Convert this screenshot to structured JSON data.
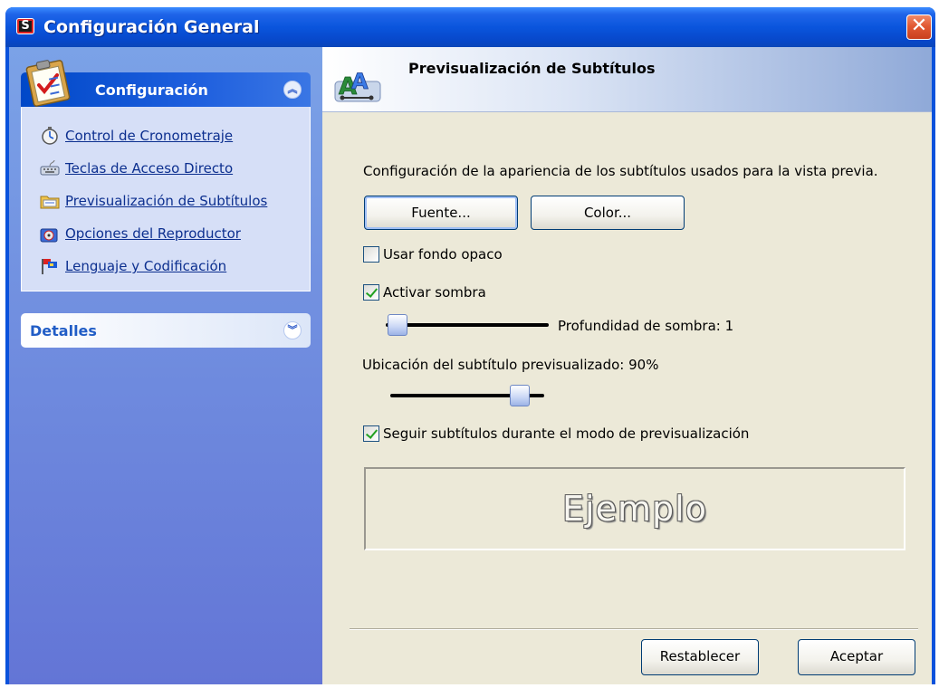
{
  "window": {
    "title": "Configuración General",
    "app_icon_letter": "S"
  },
  "sidebar": {
    "group1": {
      "title": "Configuración",
      "items": [
        {
          "label": "Control de Cronometraje",
          "icon": "stopwatch-icon"
        },
        {
          "label": "Teclas de Acceso Directo",
          "icon": "keyboard-icon"
        },
        {
          "label": "Previsualización de Subtítulos",
          "icon": "folder-icon"
        },
        {
          "label": "Opciones del Reproductor",
          "icon": "media-player-icon"
        },
        {
          "label": "Lenguaje y Codificación",
          "icon": "flags-icon"
        }
      ]
    },
    "group2": {
      "title": "Detalles"
    }
  },
  "panel": {
    "header_title": "Previsualización de Subtítulos",
    "description": "Configuración de la apariencia de los subtítulos usados para la vista previa.",
    "font_button": "Fuente...",
    "color_button": "Color...",
    "opaque_bg_label": "Usar fondo opaco",
    "opaque_bg_checked": false,
    "shadow_label": "Activar sombra",
    "shadow_checked": true,
    "shadow_depth_label": "Profundidad de sombra: 1",
    "shadow_depth_value": 1,
    "location_label": "Ubicación del subtítulo previsualizado: 90%",
    "location_value_percent": 90,
    "follow_label": "Seguir subtítulos durante el modo de previsualización",
    "follow_checked": true,
    "sample_text": "Ejemplo",
    "reset_button": "Restablecer",
    "accept_button": "Aceptar"
  }
}
